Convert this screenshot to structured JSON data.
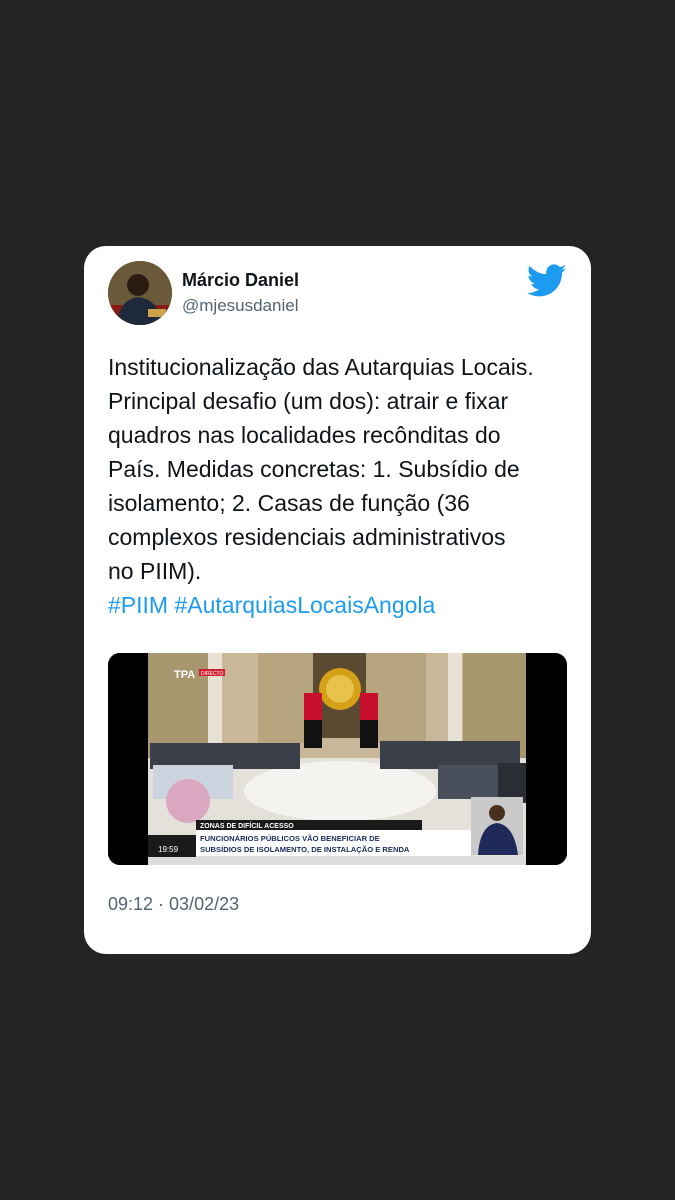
{
  "user": {
    "name": "Márcio Daniel",
    "handle": "@mjesusdaniel"
  },
  "tweet": {
    "lines": [
      "Institucionalização das Autarquias Locais.",
      "Principal desafio (um dos): atrair e fixar",
      "quadros nas localidades recônditas do",
      "País. Medidas concretas: 1. Subsídio de",
      "isolamento; 2. Casas de função (36",
      "complexos residenciais administrativos",
      "no PIIM)."
    ],
    "hashtags": [
      "#PIIM",
      "#AutarquiasLocaisAngola"
    ],
    "timestamp": "09:12 · 03/02/23"
  },
  "media": {
    "channel_logo": "TPA",
    "live_badge": "DIRECTO",
    "lower_third_label": "ZONAS DE DIFÍCIL ACESSO",
    "headline_line1": "FUNCIONÁRIOS PÚBLICOS VÃO BENEFICIAR DE",
    "headline_line2": "SUBSÍDIOS DE ISOLAMENTO, DE INSTALAÇÃO E RENDA",
    "clock": "19:59"
  },
  "icons": {
    "brand": "twitter-bird-icon",
    "avatar": "profile-avatar"
  },
  "colors": {
    "background": "#242424",
    "card": "#ffffff",
    "text": "#0f1419",
    "secondary": "#536471",
    "link": "#1d9bf0"
  }
}
